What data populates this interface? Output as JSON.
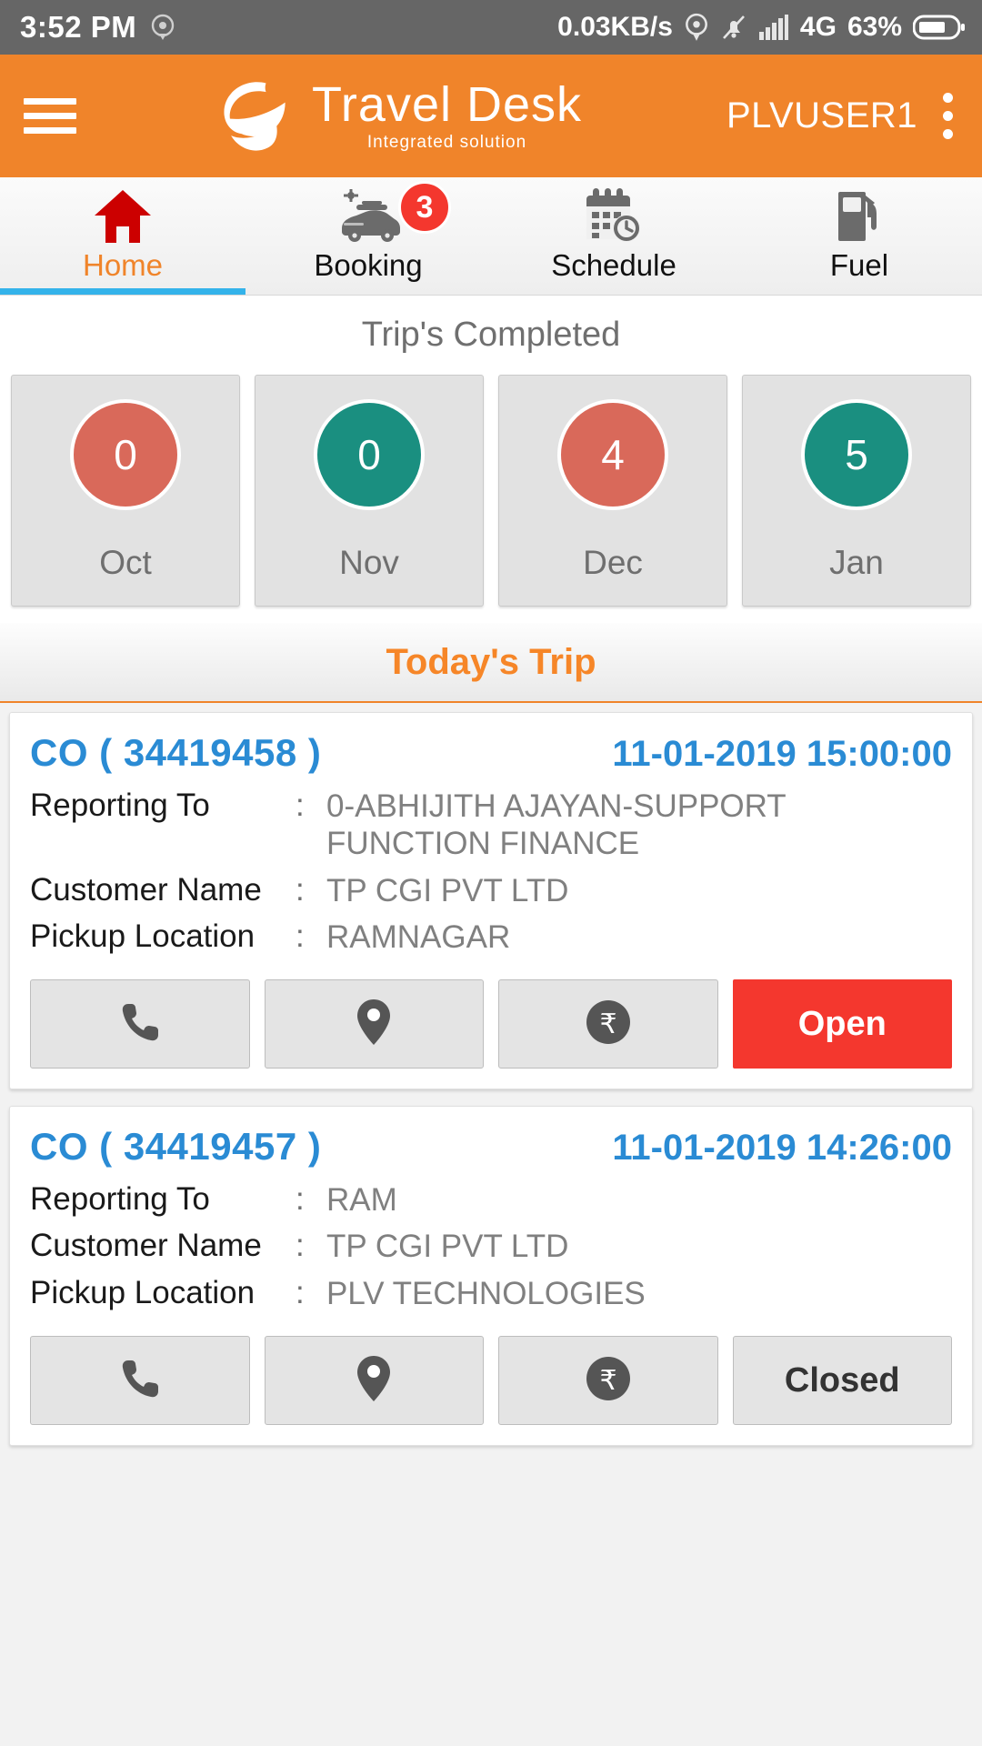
{
  "status_bar": {
    "time": "3:52 PM",
    "network_speed": "0.03KB/s",
    "network_type": "4G",
    "battery_percent": "63%",
    "icons": [
      "location-icon",
      "gps-icon",
      "mute-icon",
      "signal-icon",
      "battery-icon"
    ]
  },
  "header": {
    "menu_icon": "hamburger-menu-icon",
    "logo_icon": "travel-desk-logo-icon",
    "title": "Travel Desk",
    "subtitle": "Integrated solution",
    "user": "PLVUSER1",
    "overflow_icon": "kebab-menu-icon",
    "brand_color": "#f0842a"
  },
  "tabs": {
    "active_index": 0,
    "active_color": "#f0842a",
    "indicator_color": "#34b3ea",
    "items": [
      {
        "label": "Home",
        "icon": "home-icon",
        "badge": ""
      },
      {
        "label": "Booking",
        "icon": "car-icon",
        "badge": "3"
      },
      {
        "label": "Schedule",
        "icon": "calendar-clock-icon",
        "badge": ""
      },
      {
        "label": "Fuel",
        "icon": "fuel-pump-icon",
        "badge": ""
      }
    ]
  },
  "stats": {
    "title": "Trip's Completed",
    "colors": {
      "red": "#d9695a",
      "teal": "#1a8f80"
    },
    "months": [
      {
        "month": "Oct",
        "count": "0",
        "color": "red"
      },
      {
        "month": "Nov",
        "count": "0",
        "color": "teal"
      },
      {
        "month": "Dec",
        "count": "4",
        "color": "red"
      },
      {
        "month": "Jan",
        "count": "5",
        "color": "teal"
      }
    ]
  },
  "today": {
    "section_title": "Today's Trip",
    "labels": {
      "reporting_to": "Reporting To",
      "customer_name": "Customer Name",
      "pickup_location": "Pickup Location",
      "colon": ":"
    },
    "trips": [
      {
        "co": "CO ( 34419458 )",
        "datetime": "11-01-2019 15:00:00",
        "reporting_to": "0-ABHIJITH AJAYAN-SUPPORT FUNCTION FINANCE",
        "customer_name": "TP CGI PVT LTD",
        "pickup_location": "RAMNAGAR",
        "call_icon": "phone-icon",
        "location_icon": "map-pin-icon",
        "payment_icon": "rupee-coin-icon",
        "status_label": "Open",
        "status_style": "open",
        "status_color": "#f4372e"
      },
      {
        "co": "CO ( 34419457 )",
        "datetime": "11-01-2019 14:26:00",
        "reporting_to": "RAM",
        "customer_name": "TP CGI PVT LTD",
        "pickup_location": "PLV TECHNOLOGIES",
        "call_icon": "phone-icon",
        "location_icon": "map-pin-icon",
        "payment_icon": "rupee-coin-icon",
        "status_label": "Closed",
        "status_style": "closed",
        "status_color": "#e4e4e4"
      }
    ]
  }
}
